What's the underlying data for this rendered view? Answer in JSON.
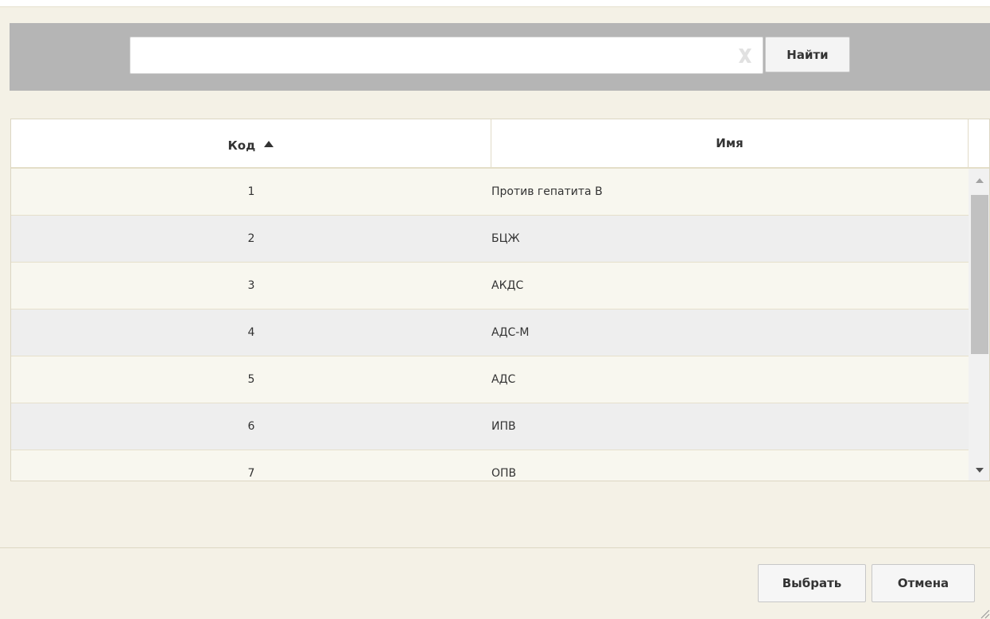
{
  "search": {
    "value": "",
    "placeholder": "",
    "find_label": "Найти"
  },
  "grid": {
    "columns": [
      {
        "label": "Код",
        "sort": "ascending"
      },
      {
        "label": "Имя"
      }
    ],
    "rows": [
      {
        "code": "1",
        "name": "Против гепатита В"
      },
      {
        "code": "2",
        "name": "БЦЖ"
      },
      {
        "code": "3",
        "name": "АКДС"
      },
      {
        "code": "4",
        "name": "АДС-М"
      },
      {
        "code": "5",
        "name": "АДС"
      },
      {
        "code": "6",
        "name": "ИПВ"
      },
      {
        "code": "7",
        "name": "ОПВ"
      }
    ]
  },
  "footer": {
    "select_label": "Выбрать",
    "cancel_label": "Отмена"
  },
  "colors": {
    "dialog_bg": "#f4f1e6",
    "search_band": "#b5b5b5",
    "row_odd": "#f8f7ef",
    "row_even": "#eeeeee"
  }
}
